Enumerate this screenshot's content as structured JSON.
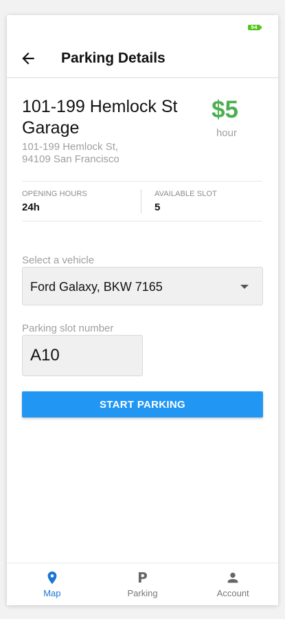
{
  "status_bar": {
    "battery": "94"
  },
  "header": {
    "title": "Parking Details",
    "back_icon": "arrow-left-icon"
  },
  "place": {
    "name": "101-199 Hemlock St Garage",
    "address_line1": "101-199 Hemlock St,",
    "address_line2": "94109 San Francisco",
    "price": "$5",
    "price_unit": "hour"
  },
  "info": {
    "opening_hours_label": "OPENING HOURS",
    "opening_hours_value": "24h",
    "available_slot_label": "AVAILABLE SLOT",
    "available_slot_value": "5"
  },
  "vehicle": {
    "label": "Select a vehicle",
    "selected": "Ford Galaxy, BKW 7165"
  },
  "slot": {
    "label": "Parking slot number",
    "value": "A10"
  },
  "actions": {
    "start_label": "START PARKING"
  },
  "nav": {
    "items": [
      {
        "label": "Map",
        "icon": "location-pin-icon",
        "active": true
      },
      {
        "label": "Parking",
        "icon": "parking-icon",
        "active": false
      },
      {
        "label": "Account",
        "icon": "person-icon",
        "active": false
      }
    ]
  },
  "colors": {
    "accent": "#2196f3",
    "price": "#4caf50",
    "active_nav": "#1976d2"
  }
}
